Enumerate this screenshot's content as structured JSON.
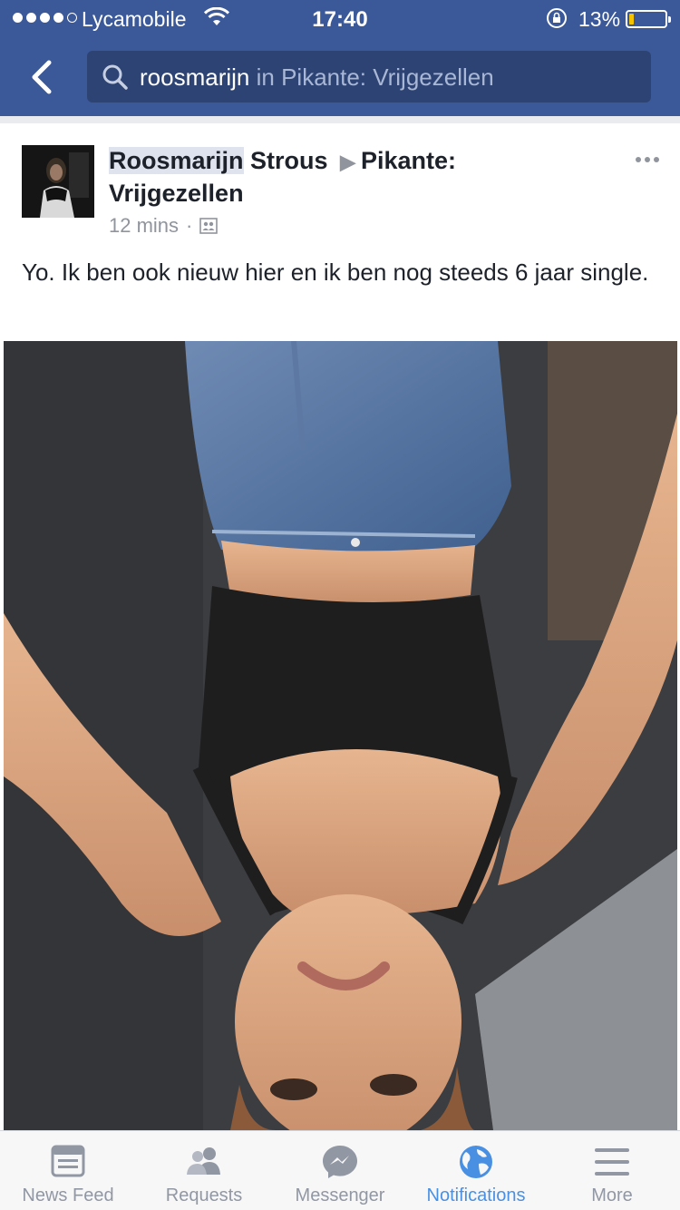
{
  "status_bar": {
    "carrier": "Lycamobile",
    "time": "17:40",
    "battery_percent_text": "13%",
    "battery_level": 0.13
  },
  "nav": {
    "search_query": "roosmarijn",
    "search_scope": "in Pikante: Vrijgezellen"
  },
  "post": {
    "author_first": "Roosmarijn",
    "author_last": "Strous",
    "group": "Pikante: Vrijgezellen",
    "time": "12 mins",
    "privacy_icon": "group-icon",
    "text": "Yo. Ik ben ook nieuw hier en ik ben nog steeds 6 jaar single."
  },
  "tabs": [
    {
      "label": "News Feed",
      "icon": "news-feed-icon",
      "active": false
    },
    {
      "label": "Requests",
      "icon": "friends-icon",
      "active": false
    },
    {
      "label": "Messenger",
      "icon": "messenger-icon",
      "active": false
    },
    {
      "label": "Notifications",
      "icon": "globe-icon",
      "active": true
    },
    {
      "label": "More",
      "icon": "menu-icon",
      "active": false
    }
  ],
  "colors": {
    "brand": "#3b5998",
    "active_tab": "#4a90e2",
    "battery_fill": "#f5c400"
  }
}
